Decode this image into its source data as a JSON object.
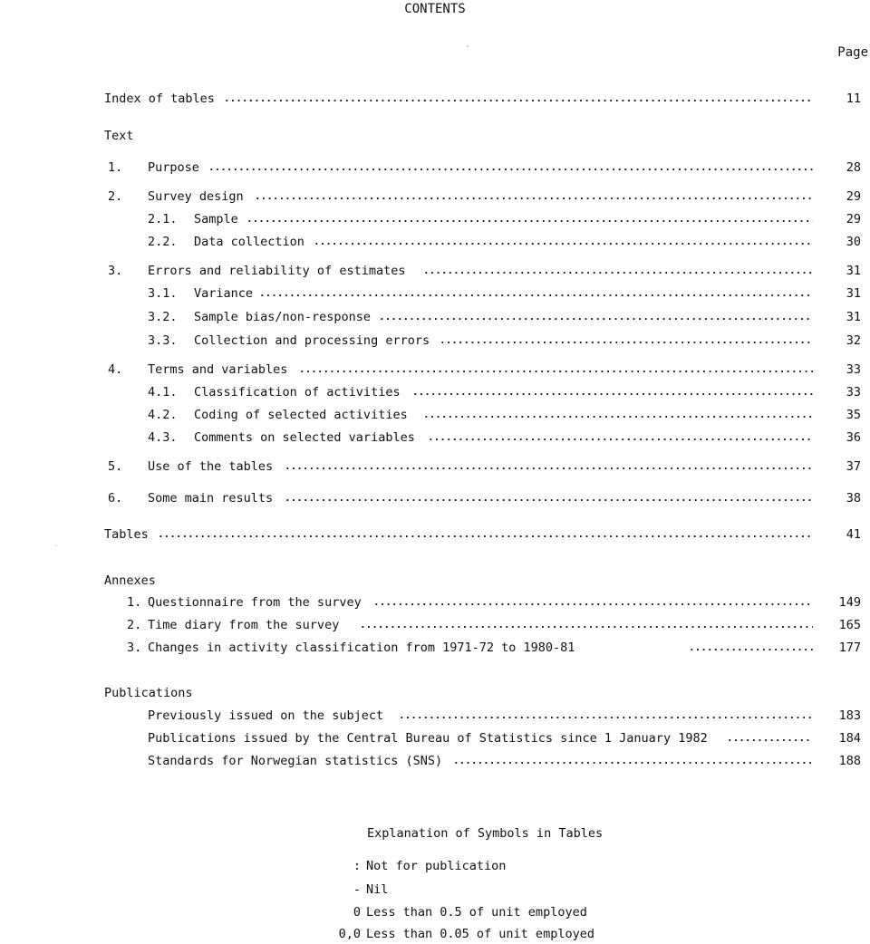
{
  "title": "CONTENTS",
  "page_header": "Page",
  "entries": [
    {
      "num": "",
      "label": "Index of tables",
      "page": "11"
    },
    {
      "num": "1.",
      "label": "Purpose",
      "page": "28"
    },
    {
      "num": "2.",
      "label": "Survey design",
      "page": "29"
    },
    {
      "num": "2.1.",
      "label": "Sample",
      "page": "29"
    },
    {
      "num": "2.2.",
      "label": "Data collection",
      "page": "30"
    },
    {
      "num": "3.",
      "label": "Errors and reliability of estimates",
      "page": "31"
    },
    {
      "num": "3.1.",
      "label": "Variance",
      "page": "31"
    },
    {
      "num": "3.2.",
      "label": "Sample bias/non-response",
      "page": "31"
    },
    {
      "num": "3.3.",
      "label": "Collection and processing errors",
      "page": "32"
    },
    {
      "num": "4.",
      "label": "Terms and variables",
      "page": "33"
    },
    {
      "num": "4.1.",
      "label": "Classification of activities",
      "page": "33"
    },
    {
      "num": "4.2.",
      "label": "Coding of selected activities",
      "page": "35"
    },
    {
      "num": "4.3.",
      "label": "Comments on selected variables",
      "page": "36"
    },
    {
      "num": "5.",
      "label": "Use of the tables",
      "page": "37"
    },
    {
      "num": "6.",
      "label": "Some main results",
      "page": "38"
    },
    {
      "num": "",
      "label": "Tables",
      "page": "41"
    },
    {
      "num": "1.",
      "label": "Questionnaire from the survey",
      "page": "149"
    },
    {
      "num": "2.",
      "label": "Time diary from the survey",
      "page": "165"
    },
    {
      "num": "3.",
      "label": "Changes in activity classification from 1971-72 to 1980-81",
      "page": "177"
    },
    {
      "num": "",
      "label": "Previously issued on the subject",
      "page": "183"
    },
    {
      "num": "",
      "label": "Publications issued by the Central Bureau of Statistics since 1 January 1982",
      "page": "184"
    },
    {
      "num": "",
      "label": "Standards for Norwegian statistics (SNS)",
      "page": "188"
    }
  ],
  "headings": {
    "text": "Text",
    "annexes": "Annexes",
    "publications": "Publications"
  },
  "legend": {
    "title": "Explanation of Symbols in Tables",
    "items": [
      {
        "symbol": ":",
        "meaning": "Not for publication"
      },
      {
        "symbol": "-",
        "meaning": "Nil"
      },
      {
        "symbol": "0",
        "meaning": "Less than 0.5 of unit employed"
      },
      {
        "symbol": "0,0",
        "meaning": "Less than 0.05 of unit employed"
      }
    ]
  }
}
